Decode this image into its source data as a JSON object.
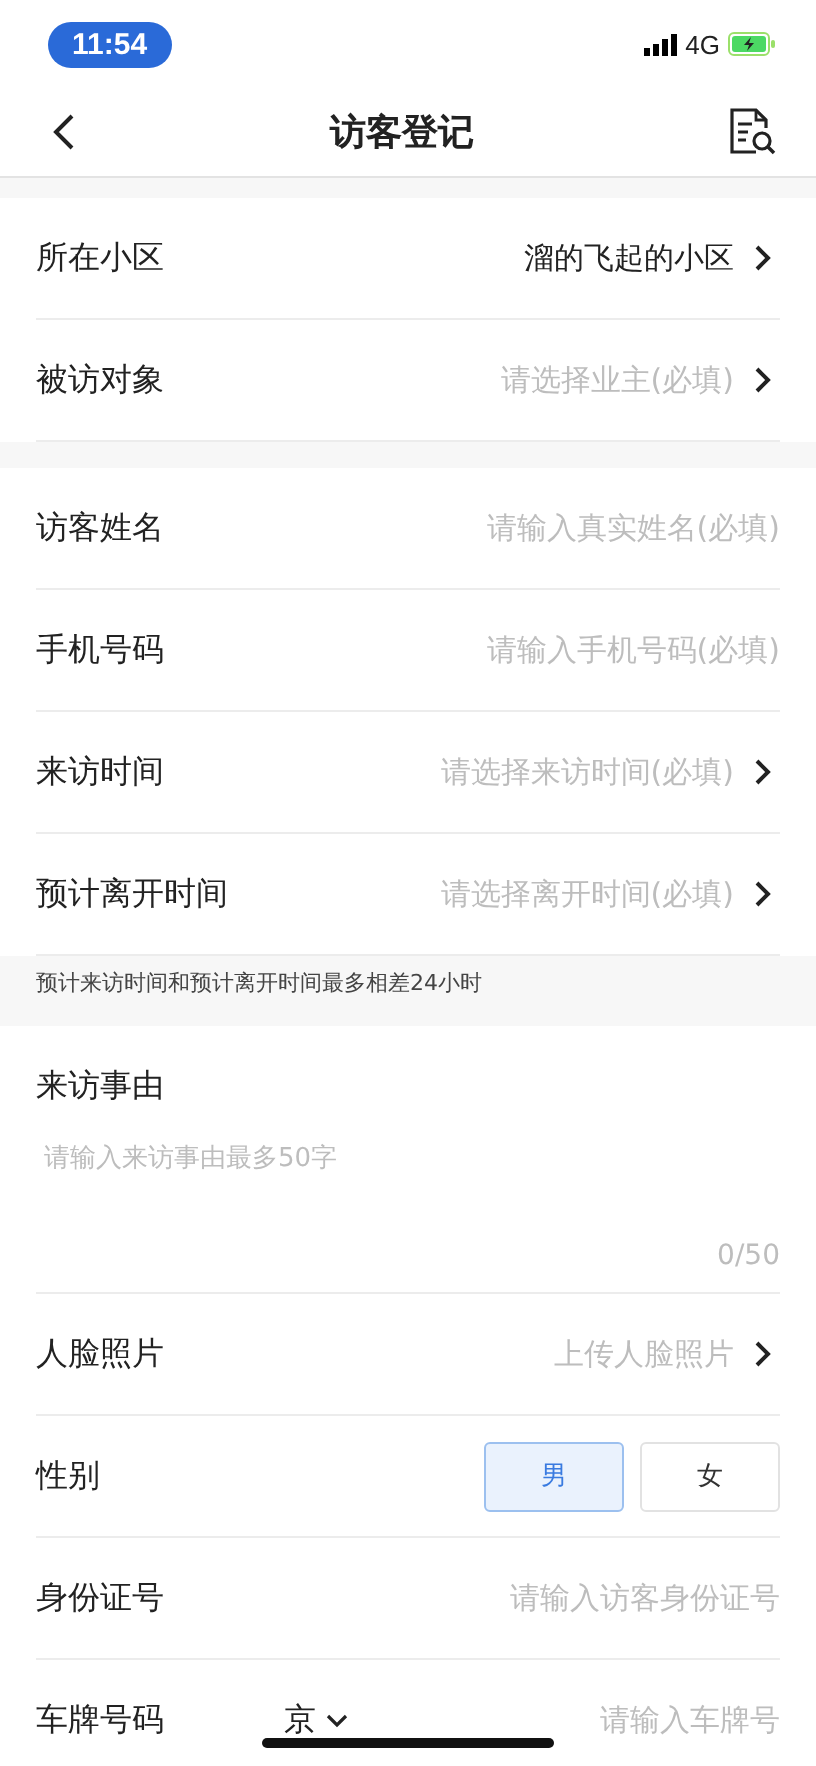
{
  "status_bar": {
    "time": "11:54",
    "network": "4G"
  },
  "nav": {
    "title": "访客登记"
  },
  "sections": [
    {
      "kind": "group",
      "rows": [
        {
          "kind": "select",
          "label": "所在小区",
          "value": "溜的飞起的小区"
        },
        {
          "kind": "select",
          "label": "被访对象",
          "placeholder": "请选择业主(必填)"
        }
      ]
    },
    {
      "kind": "group",
      "rows": [
        {
          "kind": "input",
          "label": "访客姓名",
          "placeholder": "请输入真实姓名(必填)"
        },
        {
          "kind": "input",
          "label": "手机号码",
          "placeholder": "请输入手机号码(必填)"
        },
        {
          "kind": "select",
          "label": "来访时间",
          "placeholder": "请选择来访时间(必填)"
        },
        {
          "kind": "select",
          "label": "预计离开时间",
          "placeholder": "请选择离开时间(必填)"
        }
      ]
    },
    {
      "kind": "note",
      "text": "预计来访时间和预计离开时间最多相差24小时"
    },
    {
      "kind": "group",
      "rows": [
        {
          "kind": "textarea",
          "label": "来访事由",
          "placeholder": "请输入来访事由最多50字",
          "counter": "0/50"
        },
        {
          "kind": "select",
          "label": "人脸照片",
          "placeholder": "上传人脸照片"
        },
        {
          "kind": "gender",
          "label": "性别",
          "options": [
            {
              "label": "男",
              "selected": true
            },
            {
              "label": "女",
              "selected": false
            }
          ]
        },
        {
          "kind": "input",
          "label": "身份证号",
          "placeholder": "请输入访客身份证号"
        },
        {
          "kind": "plate",
          "label": "车牌号码",
          "province": "京",
          "placeholder": "请输入车牌号"
        }
      ]
    }
  ]
}
